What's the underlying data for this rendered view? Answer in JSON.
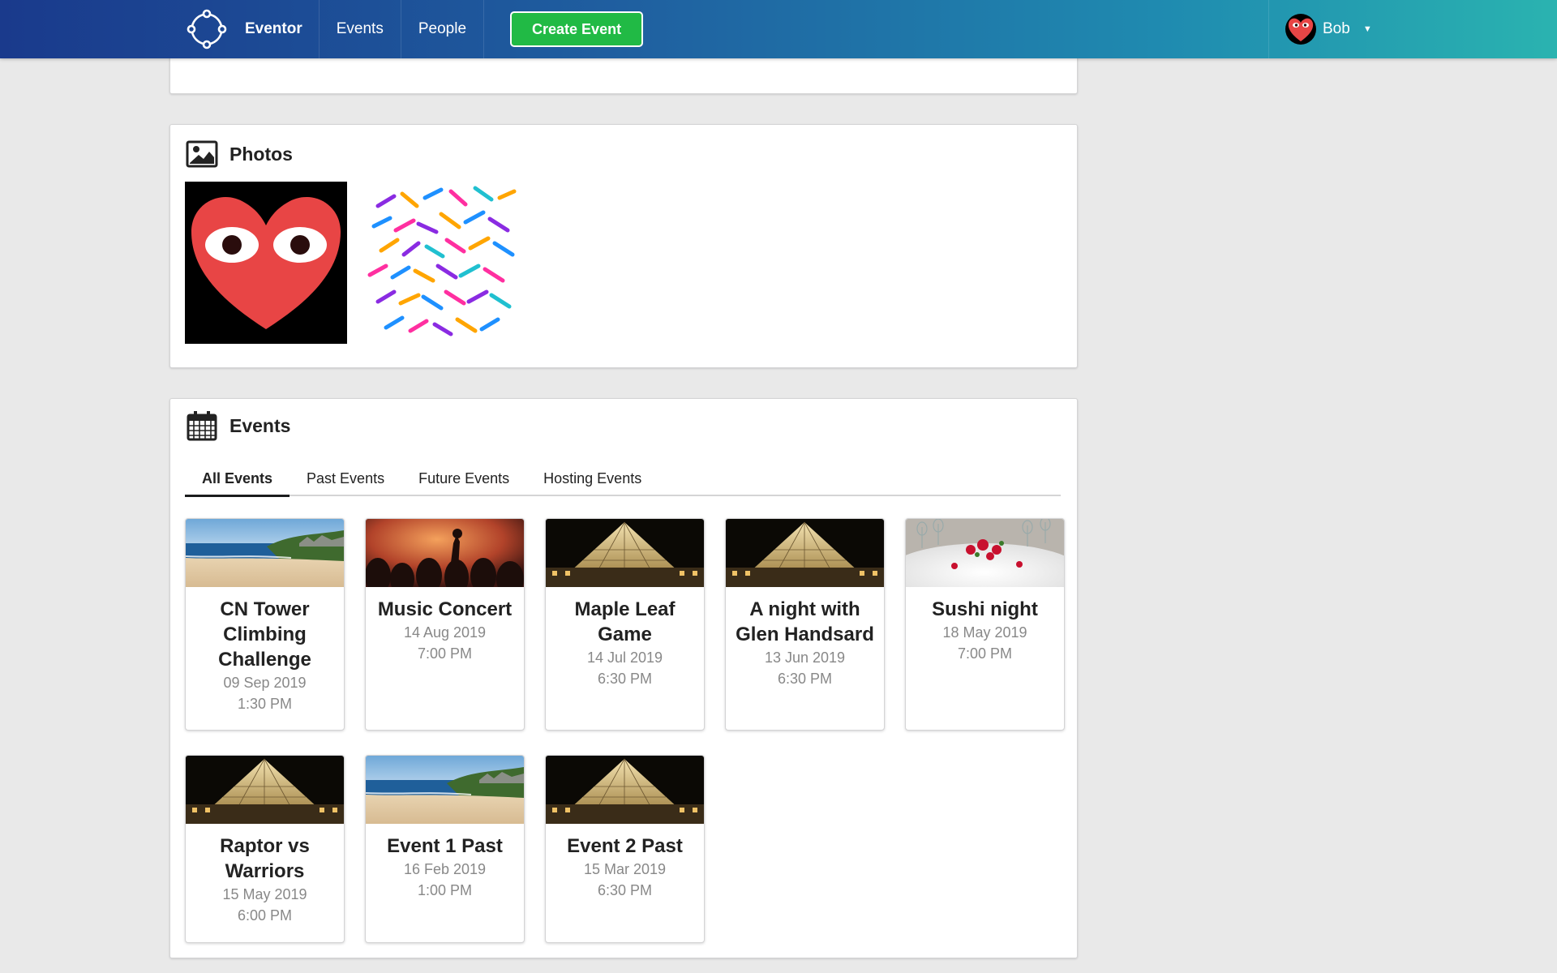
{
  "nav": {
    "brand": "Eventor",
    "items": [
      "Events",
      "People"
    ],
    "create_button": "Create Event",
    "user_name": "Bob"
  },
  "photos_section": {
    "title": "Photos",
    "photos": [
      "heart-logo-photo",
      "colorful-pattern-photo"
    ]
  },
  "events_section": {
    "title": "Events",
    "tabs": [
      "All Events",
      "Past Events",
      "Future Events",
      "Hosting Events"
    ],
    "active_tab": "All Events",
    "events": [
      {
        "title": "CN Tower Climbing Challenge",
        "date": "09 Sep 2019",
        "time": "1:30 PM",
        "image": "beach"
      },
      {
        "title": "Music Concert",
        "date": "14 Aug 2019",
        "time": "7:00 PM",
        "image": "concert"
      },
      {
        "title": "Maple Leaf Game",
        "date": "14 Jul 2019",
        "time": "6:30 PM",
        "image": "pyramid"
      },
      {
        "title": "A night with Glen Handsard",
        "date": "13 Jun 2019",
        "time": "6:30 PM",
        "image": "pyramid"
      },
      {
        "title": "Sushi night",
        "date": "18 May 2019",
        "time": "7:00 PM",
        "image": "dinner"
      },
      {
        "title": "Raptor vs Warriors",
        "date": "15 May 2019",
        "time": "6:00 PM",
        "image": "pyramid"
      },
      {
        "title": "Event 1 Past",
        "date": "16 Feb 2019",
        "time": "1:00 PM",
        "image": "beach"
      },
      {
        "title": "Event 2 Past",
        "date": "15 Mar 2019",
        "time": "6:30 PM",
        "image": "pyramid"
      }
    ]
  },
  "colors": {
    "nav_gradient_start": "#1a3a8c",
    "nav_gradient_end": "#2ab3b0",
    "create_button": "#21ba45",
    "page_background": "#e9e9e9"
  }
}
